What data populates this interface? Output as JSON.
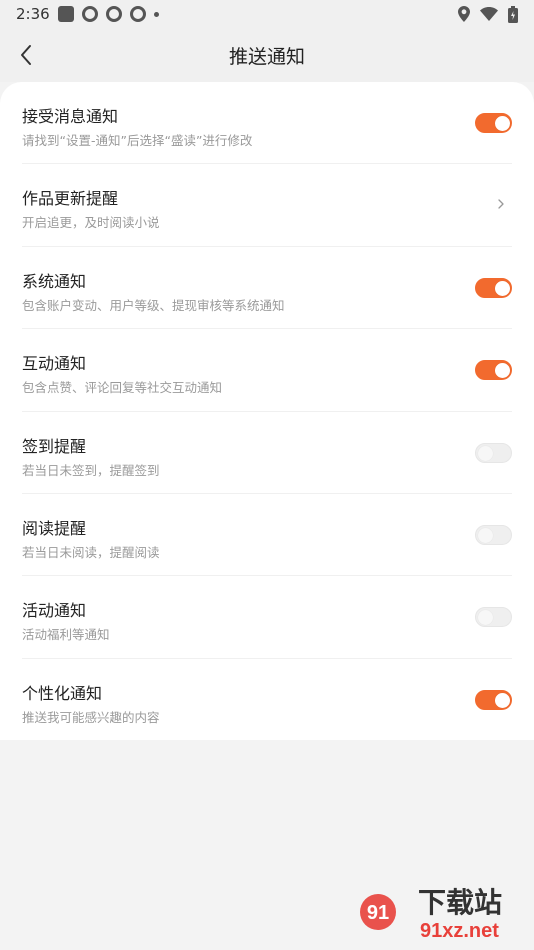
{
  "status_bar": {
    "time": "2:36"
  },
  "header": {
    "title": "推送通知"
  },
  "settings": [
    {
      "title": "接受消息通知",
      "subtitle": "请找到“设置-通知”后选择“盛读”进行修改",
      "control": "toggle",
      "on": true
    },
    {
      "title": "作品更新提醒",
      "subtitle": "开启追更，及时阅读小说",
      "control": "chevron",
      "on": null
    },
    {
      "title": "系统通知",
      "subtitle": "包含账户变动、用户等级、提现审核等系统通知",
      "control": "toggle",
      "on": true
    },
    {
      "title": "互动通知",
      "subtitle": "包含点赞、评论回复等社交互动通知",
      "control": "toggle",
      "on": true
    },
    {
      "title": "签到提醒",
      "subtitle": "若当日未签到，提醒签到",
      "control": "toggle",
      "on": false
    },
    {
      "title": "阅读提醒",
      "subtitle": "若当日未阅读，提醒阅读",
      "control": "toggle",
      "on": false
    },
    {
      "title": "活动通知",
      "subtitle": "活动福利等通知",
      "control": "toggle",
      "on": false
    },
    {
      "title": "个性化通知",
      "subtitle": "推送我可能感兴趣的内容",
      "control": "toggle",
      "on": true
    }
  ],
  "watermark": {
    "brand": "下载站",
    "domain": "91xz.net",
    "logo_text": "91"
  },
  "colors": {
    "accent": "#f26a2e",
    "background": "#f3f3f3",
    "card": "#ffffff"
  }
}
